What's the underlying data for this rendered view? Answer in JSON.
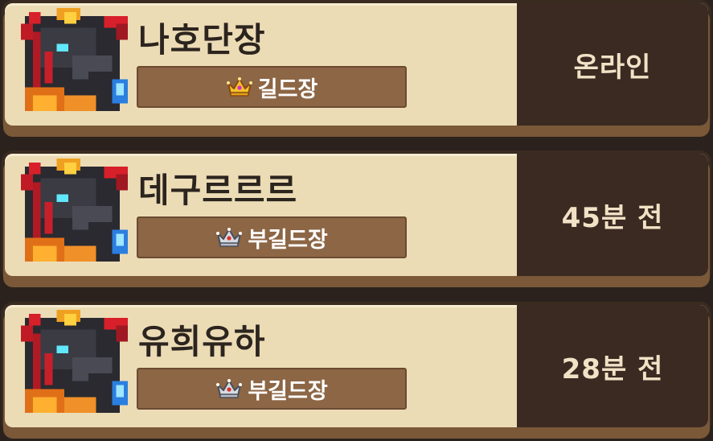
{
  "members": [
    {
      "name": "나호단장",
      "rank": "길드장",
      "rank_icon": "gold-crown-icon",
      "status": "온라인"
    },
    {
      "name": "데구르르르",
      "rank": "부길드장",
      "rank_icon": "silver-crown-icon",
      "status": "45분 전"
    },
    {
      "name": "유희유하",
      "rank": "부길드장",
      "rank_icon": "silver-crown-icon",
      "status": "28분 전"
    }
  ],
  "colors": {
    "card_bg": "#ecdcb6",
    "status_panel": "#3a2a22",
    "rank_badge": "#8c6645",
    "name_text": "#2c241e",
    "status_text": "#f1e2c6"
  }
}
